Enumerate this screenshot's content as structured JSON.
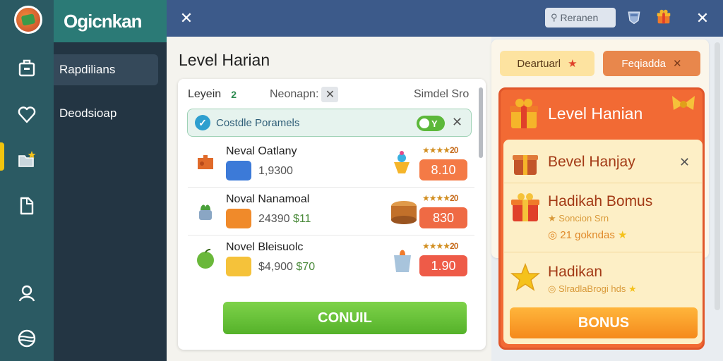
{
  "brand": {
    "name": "Ogicnkan"
  },
  "sidebar": {
    "items": [
      {
        "label": "Rapdilians",
        "active": true
      },
      {
        "label": "Deodsioap",
        "active": false
      }
    ]
  },
  "rail": {
    "icons": [
      "bag-icon",
      "heart-icon",
      "folder-star-icon",
      "document-icon",
      "user-icon",
      "globe-icon"
    ],
    "active_index": 2
  },
  "topbar": {
    "search_placeholder": "Reranen",
    "close_symbol": "✕"
  },
  "main": {
    "title": "Level Harian",
    "tabs": [
      {
        "label": "Leyein",
        "badge": "2"
      },
      {
        "label": "Neonapn:",
        "close": "✕"
      },
      {
        "label": "Simdel Sro"
      }
    ],
    "promo": {
      "label": "Costdle Poramels",
      "toggle_text": "Y",
      "close": "✕"
    },
    "rows": [
      {
        "title": "Neval Oatlany",
        "sub": "1,9300",
        "sub_accent": "",
        "stars": "★★★★",
        "stars_num": "20",
        "price": "8.10",
        "price_color": "#f47a46"
      },
      {
        "title": "Noval Nanamoal",
        "sub": "24390 ",
        "sub_accent": "$11",
        "stars": "★★★★",
        "stars_num": "20",
        "price": "830",
        "price_color": "#ef6a44"
      },
      {
        "title": "Novel Bleisuolc",
        "sub": "$4,900 ",
        "sub_accent": "$70",
        "stars": "★★★★",
        "stars_num": "20",
        "price": "1.90",
        "price_color": "#ee5b48"
      }
    ],
    "confirm_label": "CONUIL"
  },
  "right": {
    "pill_a": {
      "label": "Deartuarl",
      "icon": "★"
    },
    "pill_b": {
      "label": "Feqiadda",
      "icon": "✕"
    },
    "rewards": {
      "title": "Level Hanian",
      "cards": [
        {
          "title": "Bevel Hanjay",
          "sub": "",
          "close": "✕"
        },
        {
          "title": "Hadikah Bomus",
          "sub": "Soncion Srn",
          "sub2": "21 gokndas"
        },
        {
          "title": "Hadikan",
          "sub": "SlradlaBrogi hds"
        }
      ],
      "bonus_label": "BONUS"
    }
  },
  "colors": {
    "rail": "#2b5a63",
    "sidebar": "#233543",
    "brand_bg": "#2b7a76",
    "topbar": "#3c5a8a",
    "accent_green": "#5cb83a",
    "accent_orange": "#f26a34"
  }
}
